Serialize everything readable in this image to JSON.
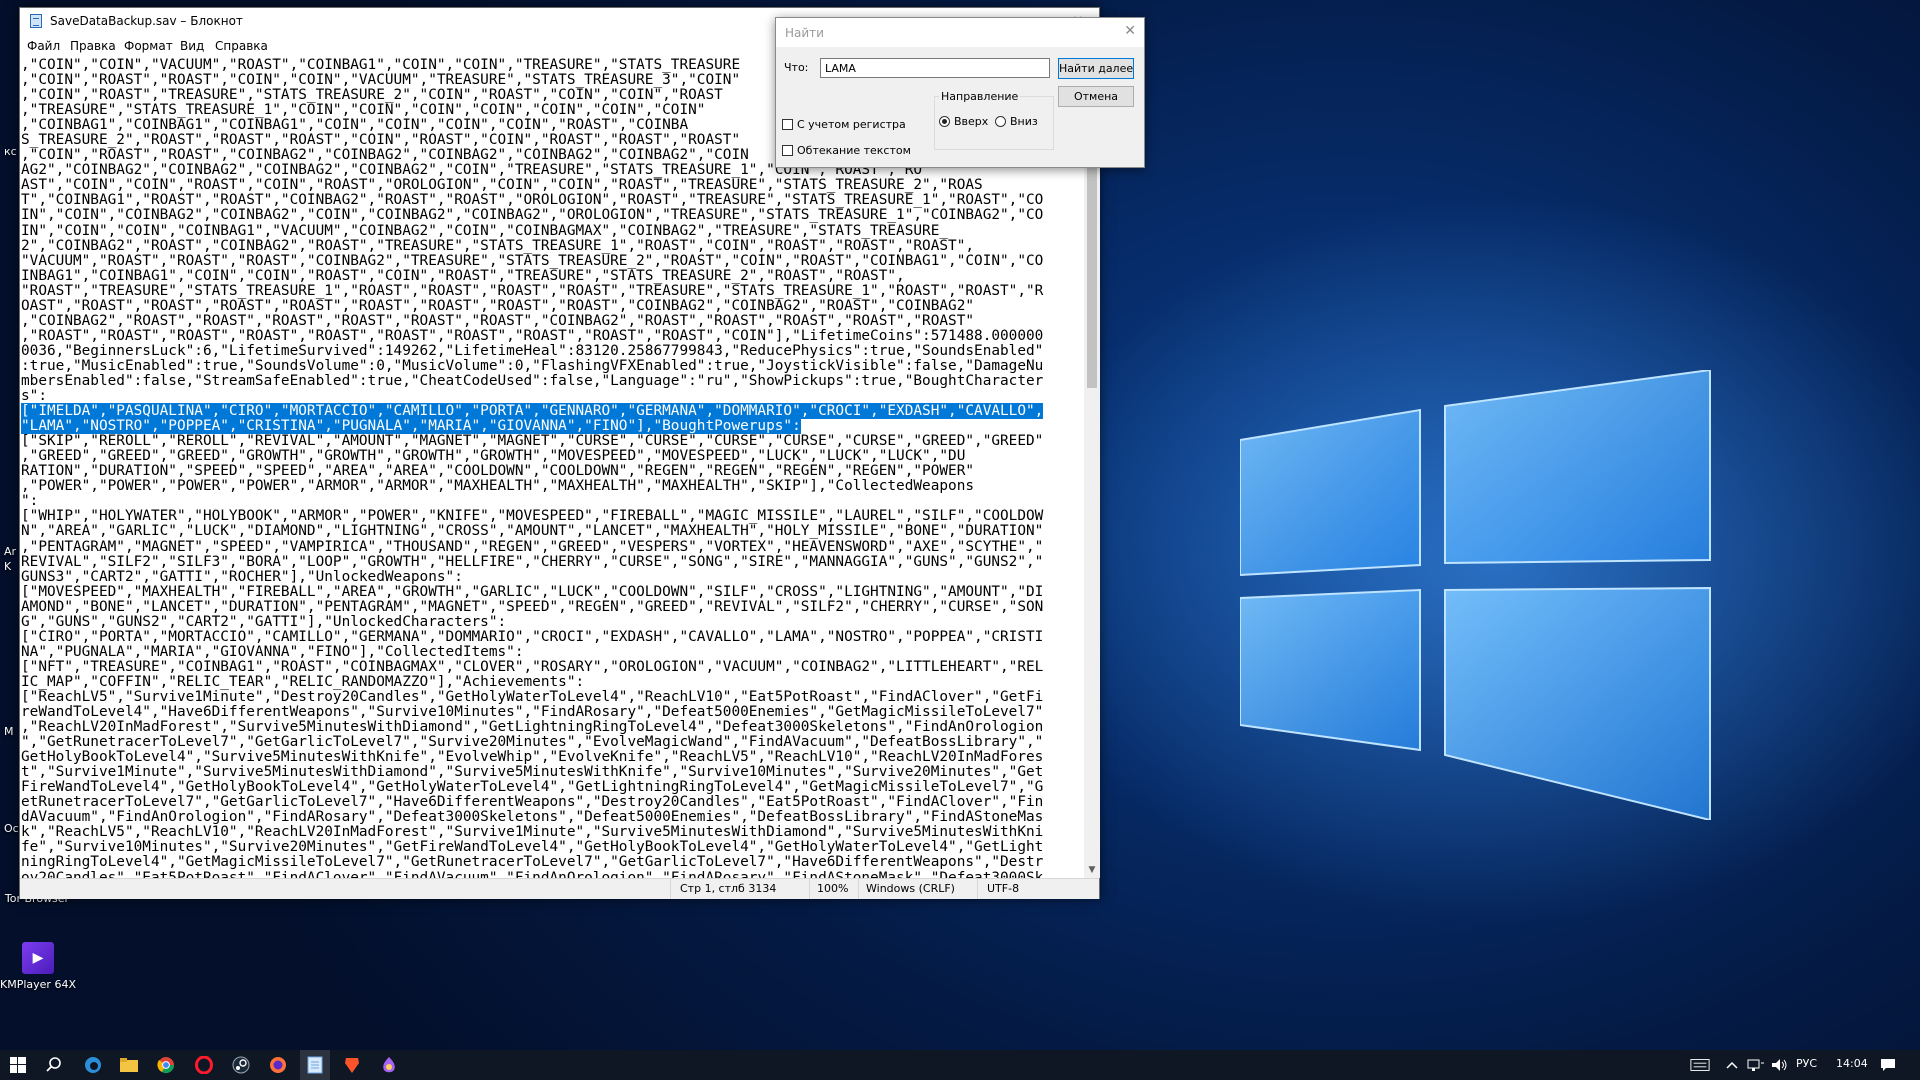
{
  "desktop": {
    "icons": [
      {
        "label": "Tor Browser",
        "id": "tor"
      },
      {
        "label": "KMPlayer 64X",
        "id": "kmplayer"
      }
    ],
    "edge_letters": [
      "кс",
      "Ar",
      "K",
      "M",
      "Oc"
    ]
  },
  "notepad": {
    "title": "SaveDataBackup.sav – Блокнот",
    "menu": [
      "Файл",
      "Правка",
      "Формат",
      "Вид",
      "Справка"
    ],
    "lines": [
      ",\"COIN\",\"COIN\",\"VACUUM\",\"ROAST\",\"COINBAG1\",\"COIN\",\"COIN\",\"TREASURE\",\"STATS_TREASURE",
      ",\"COIN\",\"ROAST\",\"ROAST\",\"COIN\",\"COIN\",\"VACUUM\",\"TREASURE\",\"STATS_TREASURE_3\",\"COIN\"",
      ",\"COIN\",\"ROAST\",\"TREASURE\",\"STATS_TREASURE_2\",\"COIN\",\"ROAST\",\"COIN\",\"COIN\",\"ROAST",
      ",\"TREASURE\",\"STATS_TREASURE_1\",\"COIN\",\"COIN\",\"COIN\",\"COIN\",\"COIN\",\"COIN\",\"COIN\"",
      ",\"COINBAG1\",\"COINBAG1\",\"COINBAG1\",\"COIN\",\"COIN\",\"COIN\",\"COIN\",\"ROAST\",\"COINBA",
      "S_TREASURE_2\",\"ROAST\",\"ROAST\",\"ROAST\",\"COIN\",\"ROAST\",\"COIN\",\"ROAST\",\"ROAST\",\"ROAST\"",
      ",\"COIN\",\"ROAST\",\"ROAST\",\"COINBAG2\",\"COINBAG2\",\"COINBAG2\",\"COINBAG2\",\"COINBAG2\",\"COIN",
      "AG2\",\"COINBAG2\",\"COINBAG2\",\"COINBAG2\",\"COINBAG2\",\"COIN\",\"TREASURE\",\"STATS_TREASURE_1\",\"COIN\",\"ROAST\",\"RO",
      "AST\",\"COIN\",\"COIN\",\"ROAST\",\"COIN\",\"ROAST\",\"OROLOGION\",\"COIN\",\"COIN\",\"ROAST\",\"TREASURE\",\"STATS_TREASURE_2\",\"ROAS",
      "T\",\"COINBAG1\",\"ROAST\",\"ROAST\",\"COINBAG2\",\"ROAST\",\"ROAST\",\"OROLOGION\",\"ROAST\",\"TREASURE\",\"STATS_TREASURE_1\",\"ROAST\",\"CO",
      "IN\",\"COIN\",\"COINBAG2\",\"COINBAG2\",\"COIN\",\"COINBAG2\",\"COINBAG2\",\"OROLOGION\",\"TREASURE\",\"STATS_TREASURE_1\",\"COINBAG2\",\"CO",
      "IN\",\"COIN\",\"COIN\",\"COINBAG1\",\"VACUUM\",\"COINBAG2\",\"COIN\",\"COINBAGMAX\",\"COINBAG2\",\"TREASURE\",\"STATS_TREASURE_",
      "2\",\"COINBAG2\",\"ROAST\",\"COINBAG2\",\"ROAST\",\"TREASURE\",\"STATS_TREASURE_1\",\"ROAST\",\"COIN\",\"ROAST\",\"ROAST\",\"ROAST\",",
      "\"VACUUM\",\"ROAST\",\"ROAST\",\"ROAST\",\"COINBAG2\",\"TREASURE\",\"STATS_TREASURE_2\",\"ROAST\",\"COIN\",\"ROAST\",\"COINBAG1\",\"COIN\",\"CO",
      "INBAG1\",\"COINBAG1\",\"COIN\",\"COIN\",\"ROAST\",\"COIN\",\"ROAST\",\"TREASURE\",\"STATS_TREASURE_2\",\"ROAST\",\"ROAST\",",
      "\"ROAST\",\"TREASURE\",\"STATS_TREASURE_1\",\"ROAST\",\"ROAST\",\"ROAST\",\"ROAST\",\"TREASURE\",\"STATS_TREASURE_1\",\"ROAST\",\"ROAST\",\"R",
      "OAST\",\"ROAST\",\"ROAST\",\"ROAST\",\"ROAST\",\"ROAST\",\"ROAST\",\"ROAST\",\"ROAST\",\"COINBAG2\",\"COINBAG2\",\"ROAST\",\"COINBAG2\"",
      ",\"COINBAG2\",\"ROAST\",\"ROAST\",\"ROAST\",\"ROAST\",\"ROAST\",\"ROAST\",\"COINBAG2\",\"ROAST\",\"ROAST\",\"ROAST\",\"ROAST\",\"ROAST\"",
      ",\"ROAST\",\"ROAST\",\"ROAST\",\"ROAST\",\"ROAST\",\"ROAST\",\"ROAST\",\"ROAST\",\"ROAST\",\"ROAST\",\"COIN\"],\"LifetimeCoins\":571488.000000",
      "0036,\"BeginnersLuck\":6,\"LifetimeSurvived\":149262,\"LifetimeHeal\":83120.25867799843,\"ReducePhysics\":true,\"SoundsEnabled\"",
      ":true,\"MusicEnabled\":true,\"SoundsVolume\":0,\"MusicVolume\":0,\"FlashingVFXEnabled\":true,\"JoystickVisible\":false,\"DamageNu",
      "mbersEnabled\":false,\"StreamSafeEnabled\":true,\"CheatCodeUsed\":false,\"Language\":\"ru\",\"ShowPickups\":true,\"BoughtCharacter",
      "s\":",
      "[\"IMELDA\",\"PASQUALINA\",\"CIRO\",\"MORTACCIO\",\"CAMILLO\",\"PORTA\",\"GENNARO\",\"GERMANA\",\"DOMMARIO\",\"CROCI\",\"EXDASH\",\"CAVALLO\",",
      "\"LAMA\",\"NOSTRO\",\"POPPEA\",\"CRISTINA\",\"PUGNALA\",\"MARIA\",\"GIOVANNA\",\"FINO\"],\"BoughtPowerups\":",
      "[\"SKIP\",\"REROLL\",\"REROLL\",\"REVIVAL\",\"AMOUNT\",\"MAGNET\",\"MAGNET\",\"CURSE\",\"CURSE\",\"CURSE\",\"CURSE\",\"CURSE\",\"GREED\",\"GREED\"",
      ",\"GREED\",\"GREED\",\"GREED\",\"GROWTH\",\"GROWTH\",\"GROWTH\",\"GROWTH\",\"MOVESPEED\",\"MOVESPEED\",\"LUCK\",\"LUCK\",\"LUCK\",\"DU",
      "RATION\",\"DURATION\",\"SPEED\",\"SPEED\",\"AREA\",\"AREA\",\"COOLDOWN\",\"COOLDOWN\",\"REGEN\",\"REGEN\",\"REGEN\",\"REGEN\",\"POWER\"",
      ",\"POWER\",\"POWER\",\"POWER\",\"POWER\",\"ARMOR\",\"ARMOR\",\"MAXHEALTH\",\"MAXHEALTH\",\"MAXHEALTH\",\"SKIP\"],\"CollectedWeapons",
      "\":",
      "[\"WHIP\",\"HOLYWATER\",\"HOLYBOOK\",\"ARMOR\",\"POWER\",\"KNIFE\",\"MOVESPEED\",\"FIREBALL\",\"MAGIC_MISSILE\",\"LAUREL\",\"SILF\",\"COOLDOW",
      "N\",\"AREA\",\"GARLIC\",\"LUCK\",\"DIAMOND\",\"LIGHTNING\",\"CROSS\",\"AMOUNT\",\"LANCET\",\"MAXHEALTH\",\"HOLY_MISSILE\",\"BONE\",\"DURATION\"",
      ",\"PENTAGRAM\",\"MAGNET\",\"SPEED\",\"VAMPIRICA\",\"THOUSAND\",\"REGEN\",\"GREED\",\"VESPERS\",\"VORTEX\",\"HEAVENSWORD\",\"AXE\",\"SCYTHE\",\"",
      "REVIVAL\",\"SILF2\",\"SILF3\",\"BORA\",\"LOOP\",\"GROWTH\",\"HELLFIRE\",\"CHERRY\",\"CURSE\",\"SONG\",\"SIRE\",\"MANNAGGIA\",\"GUNS\",\"GUNS2\",\"",
      "GUNS3\",\"CART2\",\"GATTI\",\"ROCHER\"],\"UnlockedWeapons\":",
      "[\"MOVESPEED\",\"MAXHEALTH\",\"FIREBALL\",\"AREA\",\"GROWTH\",\"GARLIC\",\"LUCK\",\"COOLDOWN\",\"SILF\",\"CROSS\",\"LIGHTNING\",\"AMOUNT\",\"DI",
      "AMOND\",\"BONE\",\"LANCET\",\"DURATION\",\"PENTAGRAM\",\"MAGNET\",\"SPEED\",\"REGEN\",\"GREED\",\"REVIVAL\",\"SILF2\",\"CHERRY\",\"CURSE\",\"SON",
      "G\",\"GUNS\",\"GUNS2\",\"CART2\",\"GATTI\"],\"UnlockedCharacters\":",
      "[\"CIRO\",\"PORTA\",\"MORTACCIO\",\"CAMILLO\",\"GERMANA\",\"DOMMARIO\",\"CROCI\",\"EXDASH\",\"CAVALLO\",\"LAMA\",\"NOSTRO\",\"POPPEA\",\"CRISTI",
      "NA\",\"PUGNALA\",\"MARIA\",\"GIOVANNA\",\"FINO\"],\"CollectedItems\":",
      "[\"NFT\",\"TREASURE\",\"COINBAG1\",\"ROAST\",\"COINBAGMAX\",\"CLOVER\",\"ROSARY\",\"OROLOGION\",\"VACUUM\",\"COINBAG2\",\"LITTLEHEART\",\"REL",
      "IC_MAP\",\"COFFIN\",\"RELIC_TEAR\",\"RELIC_RANDOMAZZO\"],\"Achievements\":",
      "[\"ReachLV5\",\"Survive1Minute\",\"Destroy20Candles\",\"GetHolyWaterToLevel4\",\"ReachLV10\",\"Eat5PotRoast\",\"FindAClover\",\"GetFi",
      "reWandToLevel4\",\"Have6DifferentWeapons\",\"Survive10Minutes\",\"FindARosary\",\"Defeat5000Enemies\",\"GetMagicMissileToLevel7\"",
      ",\"ReachLV20InMadForest\",\"Survive5MinutesWithDiamond\",\"GetLightningRingToLevel4\",\"Defeat3000Skeletons\",\"FindAnOrologion",
      "\",\"GetRunetracerToLevel7\",\"GetGarlicToLevel7\",\"Survive20Minutes\",\"EvolveMagicWand\",\"FindAVacuum\",\"DefeatBossLibrary\",\"",
      "GetHolyBookToLevel4\",\"Survive5MinutesWithKnife\",\"EvolveWhip\",\"EvolveKnife\",\"ReachLV5\",\"ReachLV10\",\"ReachLV20InMadFores",
      "t\",\"Survive1Minute\",\"Survive5MinutesWithDiamond\",\"Survive5MinutesWithKnife\",\"Survive10Minutes\",\"Survive20Minutes\",\"Get",
      "FireWandToLevel4\",\"GetHolyBookToLevel4\",\"GetHolyWaterToLevel4\",\"GetLightningRingToLevel4\",\"GetMagicMissileToLevel7\",\"G",
      "etRunetracerToLevel7\",\"GetGarlicToLevel7\",\"Have6DifferentWeapons\",\"Destroy20Candles\",\"Eat5PotRoast\",\"FindAClover\",\"Fin",
      "dAVacuum\",\"FindAnOrologion\",\"FindARosary\",\"Defeat3000Skeletons\",\"Defeat5000Enemies\",\"DefeatBossLibrary\",\"FindAStoneMas",
      "k\",\"ReachLV5\",\"ReachLV10\",\"ReachLV20InMadForest\",\"Survive1Minute\",\"Survive5MinutesWithDiamond\",\"Survive5MinutesWithKni",
      "fe\",\"Survive10Minutes\",\"Survive20Minutes\",\"GetFireWandToLevel4\",\"GetHolyBookToLevel4\",\"GetHolyWaterToLevel4\",\"GetLight",
      "ningRingToLevel4\",\"GetMagicMissileToLevel7\",\"GetRunetracerToLevel7\",\"GetGarlicToLevel7\",\"Have6DifferentWeapons\",\"Destr",
      "oy20Candles\",\"Eat5PotRoast\",\"FindAClover\",\"FindAVacuum\",\"FindAnOrologion\",\"FindARosary\",\"FindAStoneMask\",\"Defeat3000Sk"
    ],
    "selected_lines": [
      23,
      24
    ],
    "status": {
      "position": "Стр 1, стлб 3134",
      "zoom": "100%",
      "line_ending": "Windows (CRLF)",
      "encoding": "UTF-8"
    }
  },
  "find_dialog": {
    "title": "Найти",
    "what_label": "Что:",
    "search_value": "LAMA",
    "find_next_label": "Найти далее",
    "cancel_label": "Отмена",
    "direction_label": "Направление",
    "up_label": "Вверх",
    "down_label": "Вниз",
    "direction_selected": "up",
    "match_case_label": "С учетом регистра",
    "match_case_checked": false,
    "wrap_label": "Обтекание текстом",
    "wrap_checked": false
  },
  "taskbar": {
    "apps": [
      "start-icon",
      "search-icon",
      "edge-icon",
      "file-explorer-icon",
      "chrome-icon",
      "opera-icon",
      "steam-icon",
      "firefox-icon",
      "notepad-icon",
      "brave-icon",
      "tor-icon"
    ],
    "active_app": "notepad-icon",
    "language": "РУС",
    "time": "14:04"
  }
}
